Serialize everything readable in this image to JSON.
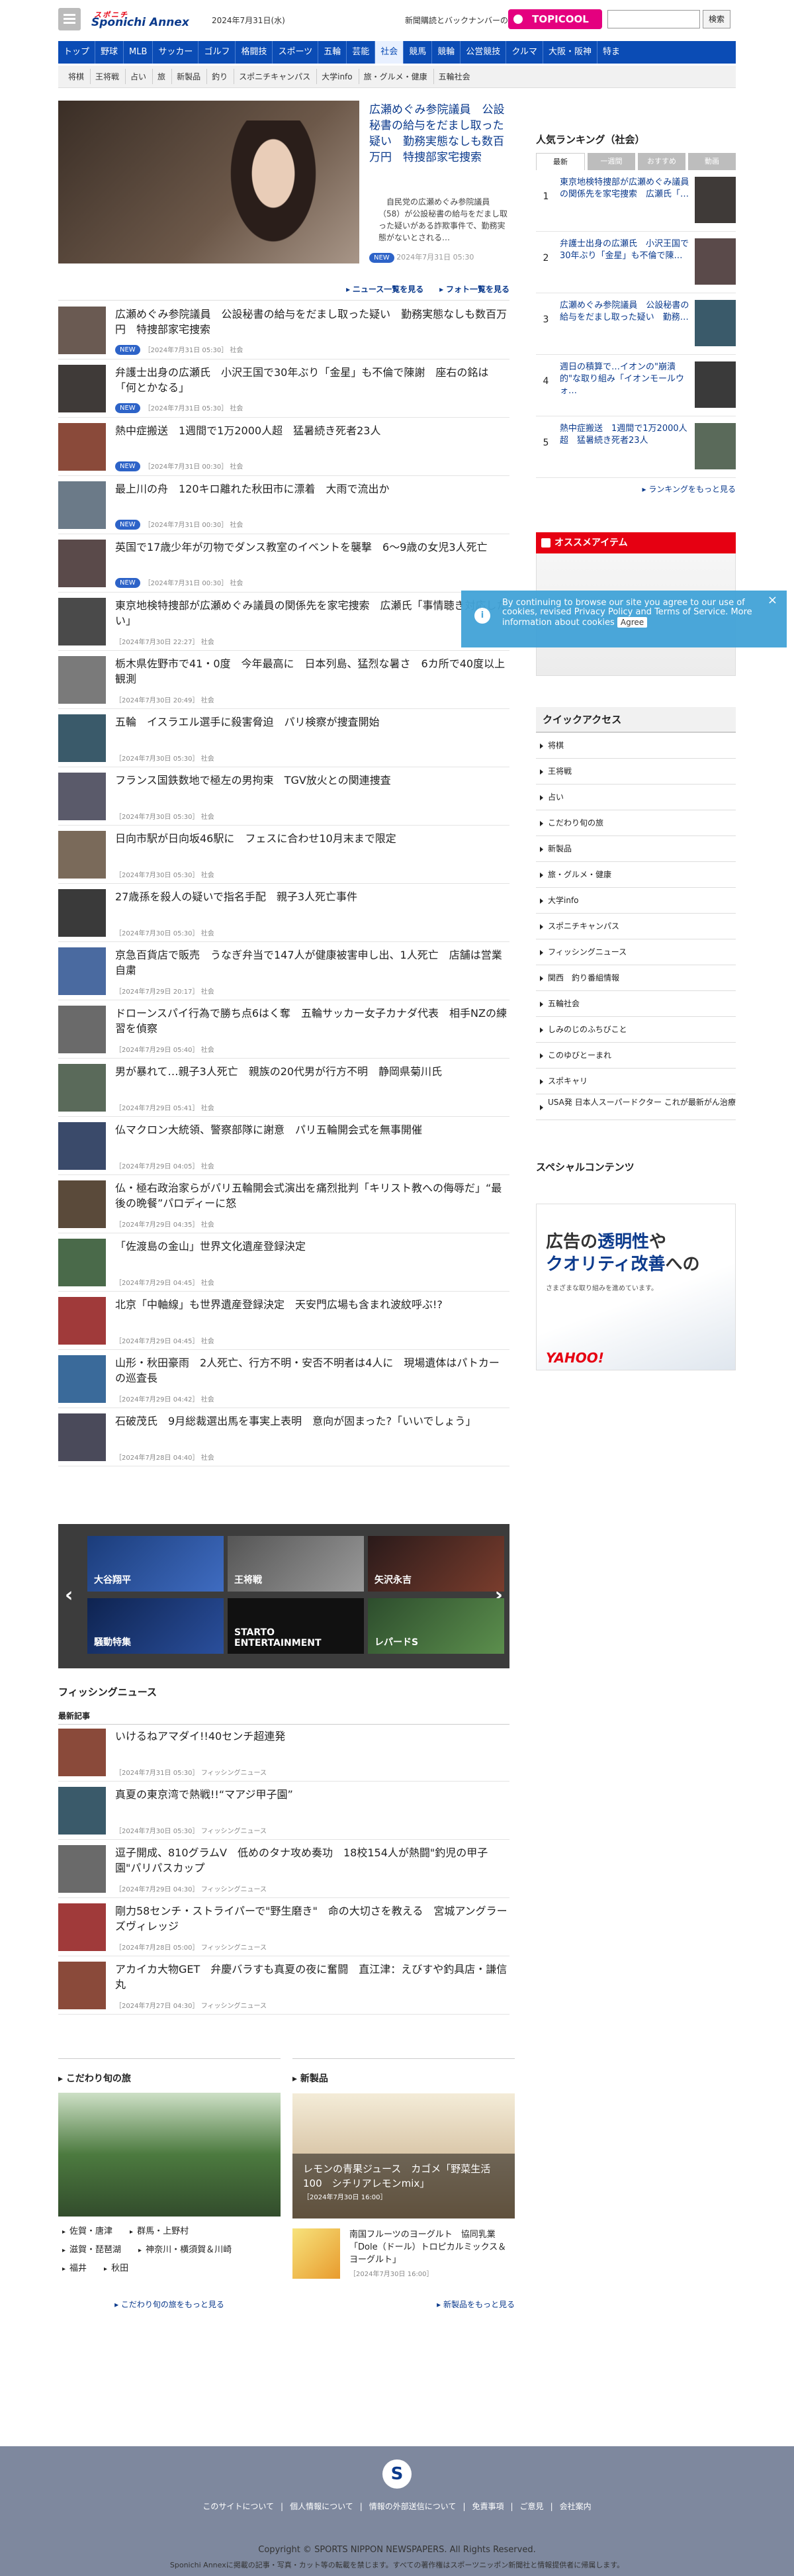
{
  "header": {
    "logo_top": "スポニチ",
    "logo": "Sponichi Annex",
    "date": "2024年7月31日(水)",
    "sub_link": "新聞購読とバックナンバーの申込み",
    "topic": "TOPICOOL",
    "search_btn": "検索",
    "search_placeholder": ""
  },
  "nav": [
    "トップ",
    "野球",
    "MLB",
    "サッカー",
    "ゴルフ",
    "格闘技",
    "スポーツ",
    "五輪",
    "芸能",
    "社会",
    "競馬",
    "競輪",
    "公営競技",
    "クルマ",
    "大阪・阪神",
    "特ま"
  ],
  "nav_active": "社会",
  "subnav": [
    "将棋",
    "王将戦",
    "占い",
    "旅",
    "新製品",
    "釣り",
    "スポニチキャンパス",
    "大学info",
    "旅・グルメ・健康",
    "五輪社会"
  ],
  "hero": {
    "title": "広瀬めぐみ参院議員　公設秘書の給与をだまし取った疑い　勤務実態なしも数百万円　特捜部家宅捜索",
    "summary": "　自民党の広瀬めぐみ参院議員（58）が公設秘書の給与をだまし取った疑いがある詐欺事件で、勤務実態がないとされる…",
    "badge": "NEW",
    "meta": "2024年7月31日 05:30",
    "news_list_link": "ニュース一覧を見る",
    "photo_list_link": "フォト一覧を見る"
  },
  "news": [
    {
      "title": "広瀬めぐみ参院議員　公設秘書の給与をだまし取った疑い　勤務実態なしも数百万円　特捜部家宅捜索",
      "new": true,
      "meta": "［2024年7月31日 05:30］ 社会"
    },
    {
      "title": "弁護士出身の広瀬氏　小沢王国で30年ぶり「金星」も不倫で陳謝　座右の銘は「何とかなる」",
      "new": true,
      "meta": "［2024年7月31日 05:30］ 社会"
    },
    {
      "title": "熱中症搬送　1週間で1万2000人超　猛暑続き死者23人",
      "new": true,
      "meta": "［2024年7月31日 00:30］ 社会"
    },
    {
      "title": "最上川の舟　120キロ離れた秋田市に漂着　大雨で流出か",
      "new": true,
      "meta": "［2024年7月31日 00:30］ 社会"
    },
    {
      "title": "英国で17歳少年が刃物でダンス教室のイベントを襲撃　6〜9歳の女児3人死亡",
      "new": true,
      "meta": "［2024年7月31日 00:30］ 社会"
    },
    {
      "title": "東京地検特捜部が広瀬めぐみ議員の関係先を家宅捜索　広瀬氏「事情聴き対応したい」",
      "new": false,
      "meta": "［2024年7月30日 22:27］ 社会"
    },
    {
      "title": "栃木県佐野市で41・0度　今年最高に　日本列島、猛烈な暑さ　6カ所で40度以上観測",
      "new": false,
      "meta": "［2024年7月30日 20:49］ 社会"
    },
    {
      "title": "五輪　イスラエル選手に殺害脅迫　パリ検察が捜査開始",
      "new": false,
      "meta": "［2024年7月30日 05:30］ 社会"
    },
    {
      "title": "フランス国鉄数地で極左の男拘束　TGV放火との関連捜査",
      "new": false,
      "meta": "［2024年7月30日 05:30］ 社会"
    },
    {
      "title": "日向市駅が日向坂46駅に　フェスに合わせ10月末まで限定",
      "new": false,
      "meta": "［2024年7月30日 05:30］ 社会"
    },
    {
      "title": "27歳孫を殺人の疑いで指名手配　親子3人死亡事件",
      "new": false,
      "meta": "［2024年7月30日 05:30］ 社会"
    },
    {
      "title": "京急百貨店で販売　うなぎ弁当で147人が健康被害申し出、1人死亡　店舗は営業自粛",
      "new": false,
      "meta": "［2024年7月29日 20:17］ 社会"
    },
    {
      "title": "ドローンスパイ行為で勝ち点6はく奪　五輪サッカー女子カナダ代表　相手NZの練習を偵察",
      "new": false,
      "meta": "［2024年7月29日 05:40］ 社会"
    },
    {
      "title": "男が暴れて…親子3人死亡　親族の20代男が行方不明　静岡県菊川氏",
      "new": false,
      "meta": "［2024年7月29日 05:41］ 社会"
    },
    {
      "title": "仏マクロン大統領、警察部隊に謝意　パリ五輪開会式を無事開催",
      "new": false,
      "meta": "［2024年7月29日 04:05］ 社会"
    },
    {
      "title": "仏・極右政治家らがパリ五輪開会式演出を痛烈批判「キリスト教への侮辱だ」“最後の晩餐”パロディーに怒",
      "new": false,
      "meta": "［2024年7月29日 04:35］ 社会"
    },
    {
      "title": "「佐渡島の金山」世界文化遺産登録決定",
      "new": false,
      "meta": "［2024年7月29日 04:45］ 社会"
    },
    {
      "title": "北京「中軸線」も世界遺産登録決定　天安門広場も含まれ波紋呼ぶ!?",
      "new": false,
      "meta": "［2024年7月29日 04:45］ 社会"
    },
    {
      "title": "山形・秋田豪雨　2人死亡、行方不明・安否不明者は4人に　現場遺体はパトカーの巡査長",
      "new": false,
      "meta": "［2024年7月29日 04:42］ 社会"
    },
    {
      "title": "石破茂氏　9月総裁選出馬を事実上表明　意向が固まった?「いいでしょう」",
      "new": false,
      "meta": "［2024年7月28日 04:40］ 社会"
    }
  ],
  "ranking": {
    "title": "人気ランキング（社会）",
    "tabs": [
      "最新",
      "一週間",
      "おすすめ",
      "動画"
    ],
    "items": [
      {
        "num": "1",
        "title": "東京地検特捜部が広瀬めぐみ議員の関係先を家宅捜索　広瀬氏「…"
      },
      {
        "num": "2",
        "title": "弁護士出身の広瀬氏　小沢王国で30年ぶり「金星」も不倫で陳…"
      },
      {
        "num": "3",
        "title": "広瀬めぐみ参院議員　公設秘書の給与をだまし取った疑い　勤務…"
      },
      {
        "num": "4",
        "title": "週日の積算で…イオンの\"崩潰的\"な取り組み「イオンモールウォ…"
      },
      {
        "num": "5",
        "title": "熱中症搬送　1週間で1万2000人超　猛暑続き死者23人"
      }
    ],
    "more": "ランキングをもっと見る"
  },
  "osusume": "オススメアイテム",
  "cookie": {
    "text": "By continuing to browse our site you agree to our use of cookies, revised Privacy Policy and Terms of Service. More information about cookies",
    "agree": "Agree",
    "close": "×"
  },
  "quick": {
    "title": "クイックアクセス",
    "items": [
      "将棋",
      "王将戦",
      "占い",
      "こだわり旬の旅",
      "新製品",
      "旅・グルメ・健康",
      "大学info",
      "スポニチキャンパス",
      "フィッシングニュース",
      "関西　釣り番組情報",
      "五輪社会",
      "しみのじのふちびこと",
      "このゆびとーまれ",
      "スポキャリ",
      "USA発 日本人スーパードクター これが最新がん治療"
    ]
  },
  "special": {
    "title": "スペシャルコンテンツ",
    "ad_line1": "広告の",
    "ad_bold1": "透明性",
    "ad_line1b": "や",
    "ad_bold2": "クオリティ改善",
    "ad_line2b": "への",
    "ad_small": "さまざまな取り組みを進めています。",
    "ad_brand": "YAHOO!"
  },
  "carousel": [
    "大谷翔平",
    "王将戦",
    "矢沢永吉",
    "騒動特集",
    "STARTO ENTERTAINMENT",
    "レパードS"
  ],
  "fishing": {
    "title": "フィッシングニュース",
    "subtitle": "最新記事",
    "items": [
      {
        "title": "いけるねアマダイ!!40センチ超連発",
        "meta": "［2024年7月31日 05:30］ フィッシングニュース"
      },
      {
        "title": "真夏の東京湾で熱戦!!“マアジ甲子園”",
        "meta": "［2024年7月30日 05:30］ フィッシングニュース"
      },
      {
        "title": "逗子開成、810グラムV　低めのタナ攻め奏功　18校154人が熱闘\"釣児の甲子園\"パリパスカップ",
        "meta": "［2024年7月29日 04:30］ フィッシングニュース"
      },
      {
        "title": "剛力58センチ・ストライパーで\"野生磨き\"　命の大切さを教える　宮城アングラーズヴィレッジ",
        "meta": "［2024年7月28日 05:00］ フィッシングニュース"
      },
      {
        "title": "アカイカ大物GET　弁慶バラすも真夏の夜に奮闘　直江津：えびすや釣具店・謙信丸",
        "meta": "［2024年7月27日 04:30］ フィッシングニュース"
      }
    ]
  },
  "kodawari": {
    "title": "こだわり旬の旅",
    "links": [
      "佐賀・唐津",
      "群馬・上野村",
      "滋賀・琵琶湖",
      "神奈川・横須賀＆川崎",
      "福井",
      "秋田"
    ],
    "more": "こだわり旬の旅をもっと見る"
  },
  "shinseihin": {
    "title": "新製品",
    "main_title": "レモンの青果ジュース　カゴメ「野菜生活100　シチリアレモンmix」",
    "main_date": "［2024年7月30日 16:00］",
    "sub_title": "南国フルーツのヨーグルト　協同乳業「Dole（ドール）トロピカルミックス＆ヨーグルト」",
    "sub_date": "［2024年7月30日 16:00］",
    "more": "新製品をもっと見る"
  },
  "footer": {
    "logo": "S",
    "links": [
      "このサイトについて",
      "個人情報について",
      "情報の外部送信について",
      "免責事項",
      "ご意見",
      "会社案内"
    ],
    "copy": "Copyright © SPORTS NIPPON NEWSPAPERS. All Rights Reserved.",
    "copy2": "Sponichi Annexに掲載の記事・写真・カット等の転載を禁じます。すべての著作権はスポーツニッポン新聞社と情報提供者に帰属します。"
  }
}
